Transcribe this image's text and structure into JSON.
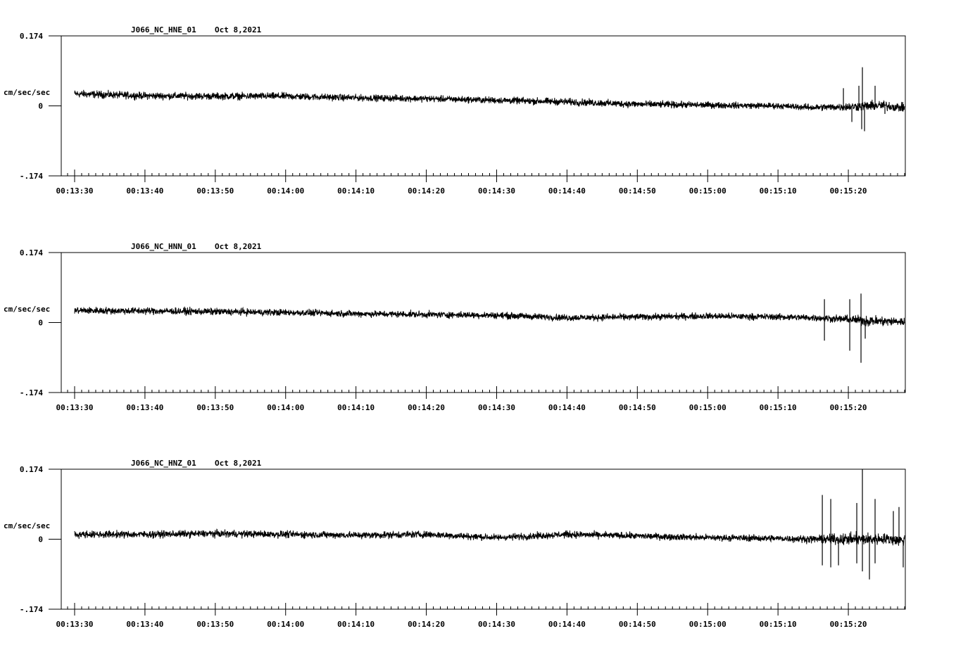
{
  "chart_data": [
    {
      "type": "line",
      "title": "J066_NC_HNE_01",
      "date": "Oct 8,2021",
      "ylabel": "cm/sec/sec",
      "yticks": [
        "0.174",
        "0",
        "-.174"
      ],
      "ylim": [
        -0.174,
        0.174
      ],
      "xticks": [
        "00:13:30",
        "00:13:40",
        "00:13:50",
        "00:14:00",
        "00:14:10",
        "00:14:20",
        "00:14:30",
        "00:14:40",
        "00:14:50",
        "00:15:00",
        "00:15:10",
        "00:15:20"
      ],
      "xlim_seconds": [
        -1.9,
        118.1
      ],
      "series": [
        {
          "x": [
            0,
            10,
            20,
            30,
            40,
            50,
            60,
            70,
            80,
            90,
            100,
            105,
            110,
            113,
            115,
            118
          ],
          "center": [
            0.03,
            0.025,
            0.024,
            0.024,
            0.02,
            0.018,
            0.014,
            0.01,
            0.004,
            0.002,
            0.0,
            -0.004,
            -0.002,
            0.0,
            0.001,
            -0.005
          ],
          "amplitude": [
            0.014,
            0.013,
            0.013,
            0.013,
            0.012,
            0.012,
            0.012,
            0.013,
            0.013,
            0.012,
            0.011,
            0.012,
            0.015,
            0.018,
            0.017,
            0.016
          ],
          "spikes": [
            [
              109.3,
              0.044
            ],
            [
              110.5,
              -0.04
            ],
            [
              111.5,
              0.05
            ],
            [
              111.9,
              -0.058
            ],
            [
              112.0,
              0.096
            ],
            [
              112.3,
              -0.063
            ],
            [
              113.8,
              0.05
            ],
            [
              115.2,
              -0.02
            ]
          ]
        }
      ]
    },
    {
      "type": "line",
      "title": "J066_NC_HNN_01",
      "date": "Oct 8,2021",
      "ylabel": "cm/sec/sec",
      "yticks": [
        "0.174",
        "0",
        "-.174"
      ],
      "ylim": [
        -0.174,
        0.174
      ],
      "xticks": [
        "00:13:30",
        "00:13:40",
        "00:13:50",
        "00:14:00",
        "00:14:10",
        "00:14:20",
        "00:14:30",
        "00:14:40",
        "00:14:50",
        "00:15:00",
        "00:15:10",
        "00:15:20"
      ],
      "xlim_seconds": [
        -1.9,
        118.1
      ],
      "series": [
        {
          "x": [
            0,
            10,
            20,
            30,
            40,
            50,
            60,
            70,
            80,
            90,
            100,
            105,
            110,
            113,
            115,
            118
          ],
          "center": [
            0.03,
            0.029,
            0.027,
            0.025,
            0.022,
            0.02,
            0.018,
            0.012,
            0.014,
            0.016,
            0.014,
            0.012,
            0.008,
            0.004,
            0.003,
            0.002
          ],
          "amplitude": [
            0.013,
            0.013,
            0.013,
            0.012,
            0.012,
            0.012,
            0.012,
            0.012,
            0.012,
            0.012,
            0.012,
            0.012,
            0.014,
            0.02,
            0.018,
            0.015
          ],
          "spikes": [
            [
              106.6,
              0.058
            ],
            [
              106.6,
              -0.045
            ],
            [
              110.2,
              0.058
            ],
            [
              110.2,
              -0.07
            ],
            [
              111.8,
              0.072
            ],
            [
              111.8,
              -0.1
            ],
            [
              112.4,
              -0.04
            ]
          ]
        }
      ]
    },
    {
      "type": "line",
      "title": "J066_NC_HNZ_01",
      "date": "Oct 8,2021",
      "ylabel": "cm/sec/sec",
      "yticks": [
        "0.174",
        "0",
        "-.174"
      ],
      "ylim": [
        -0.174,
        0.174
      ],
      "xticks": [
        "00:13:30",
        "00:13:40",
        "00:13:50",
        "00:14:00",
        "00:14:10",
        "00:14:20",
        "00:14:30",
        "00:14:40",
        "00:14:50",
        "00:15:00",
        "00:15:10",
        "00:15:20"
      ],
      "xlim_seconds": [
        -1.9,
        118.1
      ],
      "series": [
        {
          "x": [
            0,
            10,
            20,
            30,
            40,
            50,
            60,
            70,
            80,
            90,
            100,
            105,
            110,
            113,
            115,
            118
          ],
          "center": [
            0.012,
            0.012,
            0.014,
            0.012,
            0.01,
            0.012,
            0.004,
            0.012,
            0.008,
            0.004,
            0.002,
            0.0,
            0.0,
            0.0,
            0.001,
            -0.004
          ],
          "amplitude": [
            0.013,
            0.013,
            0.013,
            0.013,
            0.013,
            0.013,
            0.012,
            0.013,
            0.012,
            0.012,
            0.012,
            0.014,
            0.022,
            0.022,
            0.02,
            0.02
          ],
          "spikes": [
            [
              106.3,
              0.11
            ],
            [
              106.3,
              -0.065
            ],
            [
              107.5,
              0.1
            ],
            [
              107.5,
              -0.07
            ],
            [
              108.6,
              -0.065
            ],
            [
              111.2,
              0.09
            ],
            [
              111.2,
              -0.06
            ],
            [
              112.0,
              0.174
            ],
            [
              112.0,
              -0.08
            ],
            [
              113.0,
              -0.1
            ],
            [
              113.8,
              0.1
            ],
            [
              113.8,
              -0.06
            ],
            [
              116.4,
              0.07
            ],
            [
              117.2,
              0.08
            ],
            [
              117.8,
              -0.07
            ]
          ]
        }
      ]
    }
  ]
}
